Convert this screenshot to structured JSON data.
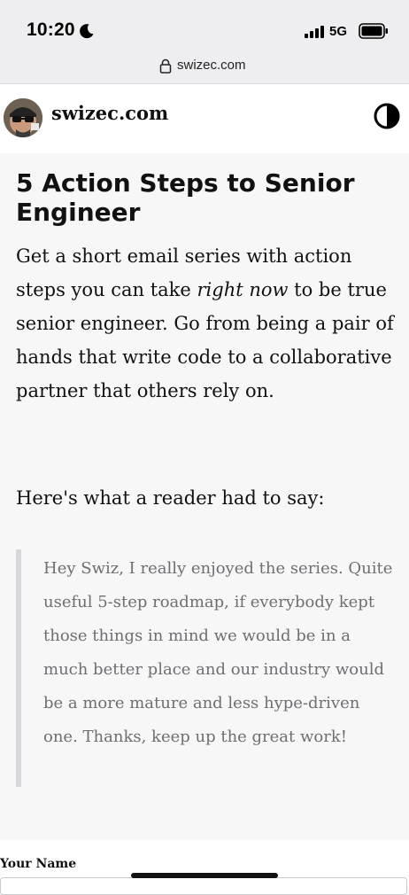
{
  "status_bar": {
    "time": "10:20",
    "network": "5G",
    "icons": [
      "moon-icon",
      "signal-icon",
      "battery-icon"
    ]
  },
  "browser": {
    "url": "swizec.com",
    "lock_icon": "lock-icon"
  },
  "header": {
    "site_name": "swizec.com",
    "theme_toggle_icon": "half-circle-contrast-icon"
  },
  "main": {
    "title": "5 Action Steps to Senior Engineer",
    "intro_before": "Get a short email series with action steps you can take ",
    "intro_emphasis": "right now",
    "intro_after": " to be true senior engineer. Go from being a pair of hands that write code to a collaborative partner that others rely on.",
    "reader_intro": "Here's what a reader had to say:",
    "testimonial": "Hey Swiz, I really enjoyed the series. Quite useful 5-step roadmap, if everybody kept those things in mind we would be in a much better place and our industry would be a more mature and less hype-driven one. Thanks, keep up the great work!"
  },
  "form": {
    "name_label": "Your Name"
  },
  "colors": {
    "chrome_background": "#eeeef1",
    "page_background": "#f7f7f7",
    "header_background": "#ffffff",
    "text": "#111111",
    "quote_text": "#6e6e73",
    "quote_border": "#d7d7dc"
  }
}
